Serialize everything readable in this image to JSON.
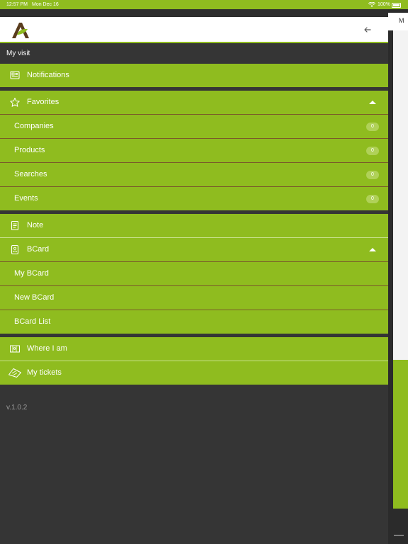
{
  "status_bar": {
    "time": "12:57 PM",
    "date": "Mon Dec 16",
    "battery": "100%"
  },
  "drawer": {
    "section_title": "My visit",
    "items": [
      {
        "label": "Notifications",
        "icon": "news-icon"
      },
      {
        "label": "Favorites",
        "icon": "star-icon"
      },
      {
        "label": "Companies",
        "badge": "0"
      },
      {
        "label": "Products",
        "badge": "0"
      },
      {
        "label": "Searches",
        "badge": "0"
      },
      {
        "label": "Events",
        "badge": "0"
      },
      {
        "label": "Note",
        "icon": "note-icon"
      },
      {
        "label": "BCard",
        "icon": "bcard-icon"
      },
      {
        "label": "My BCard"
      },
      {
        "label": "New BCard"
      },
      {
        "label": "BCard List"
      },
      {
        "label": "Where I am",
        "icon": "map-icon"
      },
      {
        "label": "My tickets",
        "icon": "ticket-icon"
      }
    ],
    "version": "v.1.0.2"
  },
  "background": {
    "header_letter": "M"
  },
  "colors": {
    "accent": "#8fbc1f",
    "drawer_bg": "#353535",
    "brand_brown": "#5a3d1e"
  }
}
